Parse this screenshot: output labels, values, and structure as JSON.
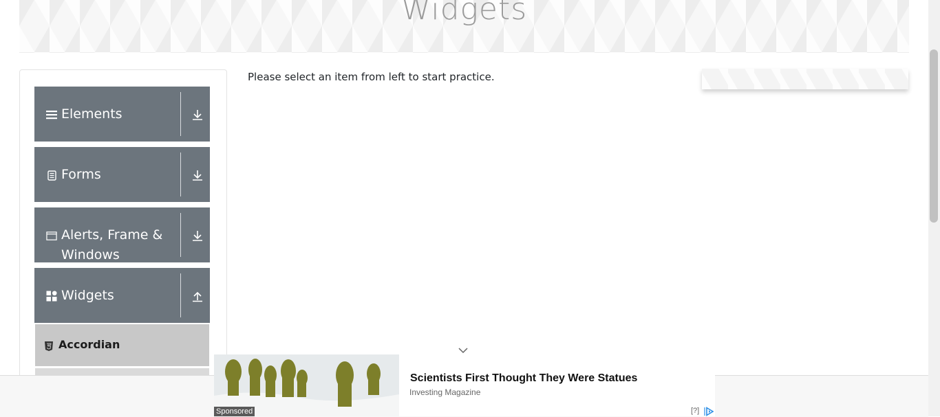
{
  "banner": {
    "title": "Widgets"
  },
  "sidebar": {
    "groups": [
      {
        "label": "Elements",
        "icon": "menu-icon",
        "arrow": "download-arrow-icon"
      },
      {
        "label": "Forms",
        "icon": "document-icon",
        "arrow": "download-arrow-icon"
      },
      {
        "label": "Alerts, Frame & Windows",
        "icon": "window-icon",
        "arrow": "download-arrow-icon"
      },
      {
        "label": "Widgets",
        "icon": "widgets-icon",
        "arrow": "upload-arrow-icon"
      }
    ],
    "sub_items": [
      {
        "label": "Accordian",
        "icon": "html5-icon"
      }
    ]
  },
  "main": {
    "message": "Please select an item from left to start practice."
  },
  "ad": {
    "headline": "Scientists First Thought They Were Statues",
    "source": "Investing Magazine",
    "sponsored": "Sponsored",
    "help": "[?]"
  },
  "colors": {
    "sidebar_header": "#6c757d",
    "active_sub_item": "#c8c8c8",
    "banner_text": "#9a9a9a"
  }
}
